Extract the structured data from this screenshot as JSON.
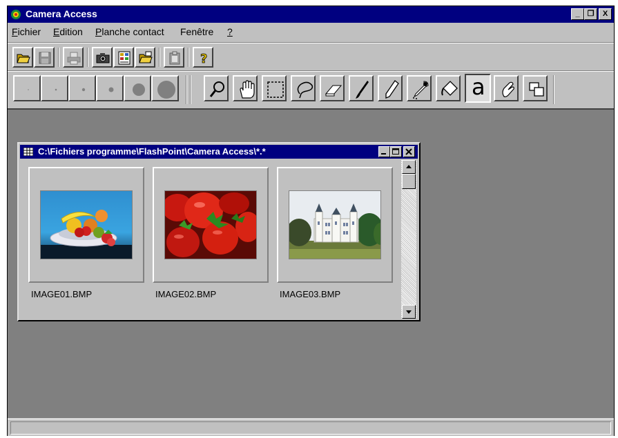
{
  "window": {
    "title": "Camera Access",
    "buttons": [
      "_",
      "❐",
      "X"
    ]
  },
  "menu": [
    {
      "underline": "F",
      "rest": "ichier"
    },
    {
      "underline": "E",
      "rest": "dition"
    },
    {
      "underline": "P",
      "rest": "lanche contact"
    },
    {
      "underline": "",
      "rest": "Fenêtre"
    },
    {
      "underline": "?",
      "rest": ""
    }
  ],
  "toolbar1": [
    "open-folder-icon",
    "save-icon",
    "print-icon",
    "camera-icon",
    "contact-sheet-icon",
    "open-album-icon",
    "clipboard-icon",
    "help-icon"
  ],
  "toolbar2": {
    "brush_sizes": [
      "brush-size-1-icon",
      "brush-size-2-icon",
      "brush-size-3-icon",
      "brush-size-4-icon",
      "brush-size-5-icon",
      "brush-size-6-icon"
    ],
    "tools": [
      "zoom-icon",
      "hand-icon",
      "rect-select-icon",
      "lasso-icon",
      "eraser-icon",
      "brush-icon",
      "pencil-icon",
      "eyedropper-icon",
      "fill-icon",
      "text-icon",
      "smudge-icon",
      "layers-icon"
    ],
    "text_tool_glyph": "a"
  },
  "child_window": {
    "title": "C:\\Fichiers programme\\FlashPoint\\Camera Access\\*.*",
    "thumbnails": [
      {
        "filename": "IMAGE01.BMP",
        "subject": "fruit-bowl"
      },
      {
        "filename": "IMAGE02.BMP",
        "subject": "strawberries"
      },
      {
        "filename": "IMAGE03.BMP",
        "subject": "castle"
      }
    ]
  },
  "colors": {
    "titlebar": "#000080",
    "face": "#c0c0c0",
    "workspace": "#808080"
  }
}
